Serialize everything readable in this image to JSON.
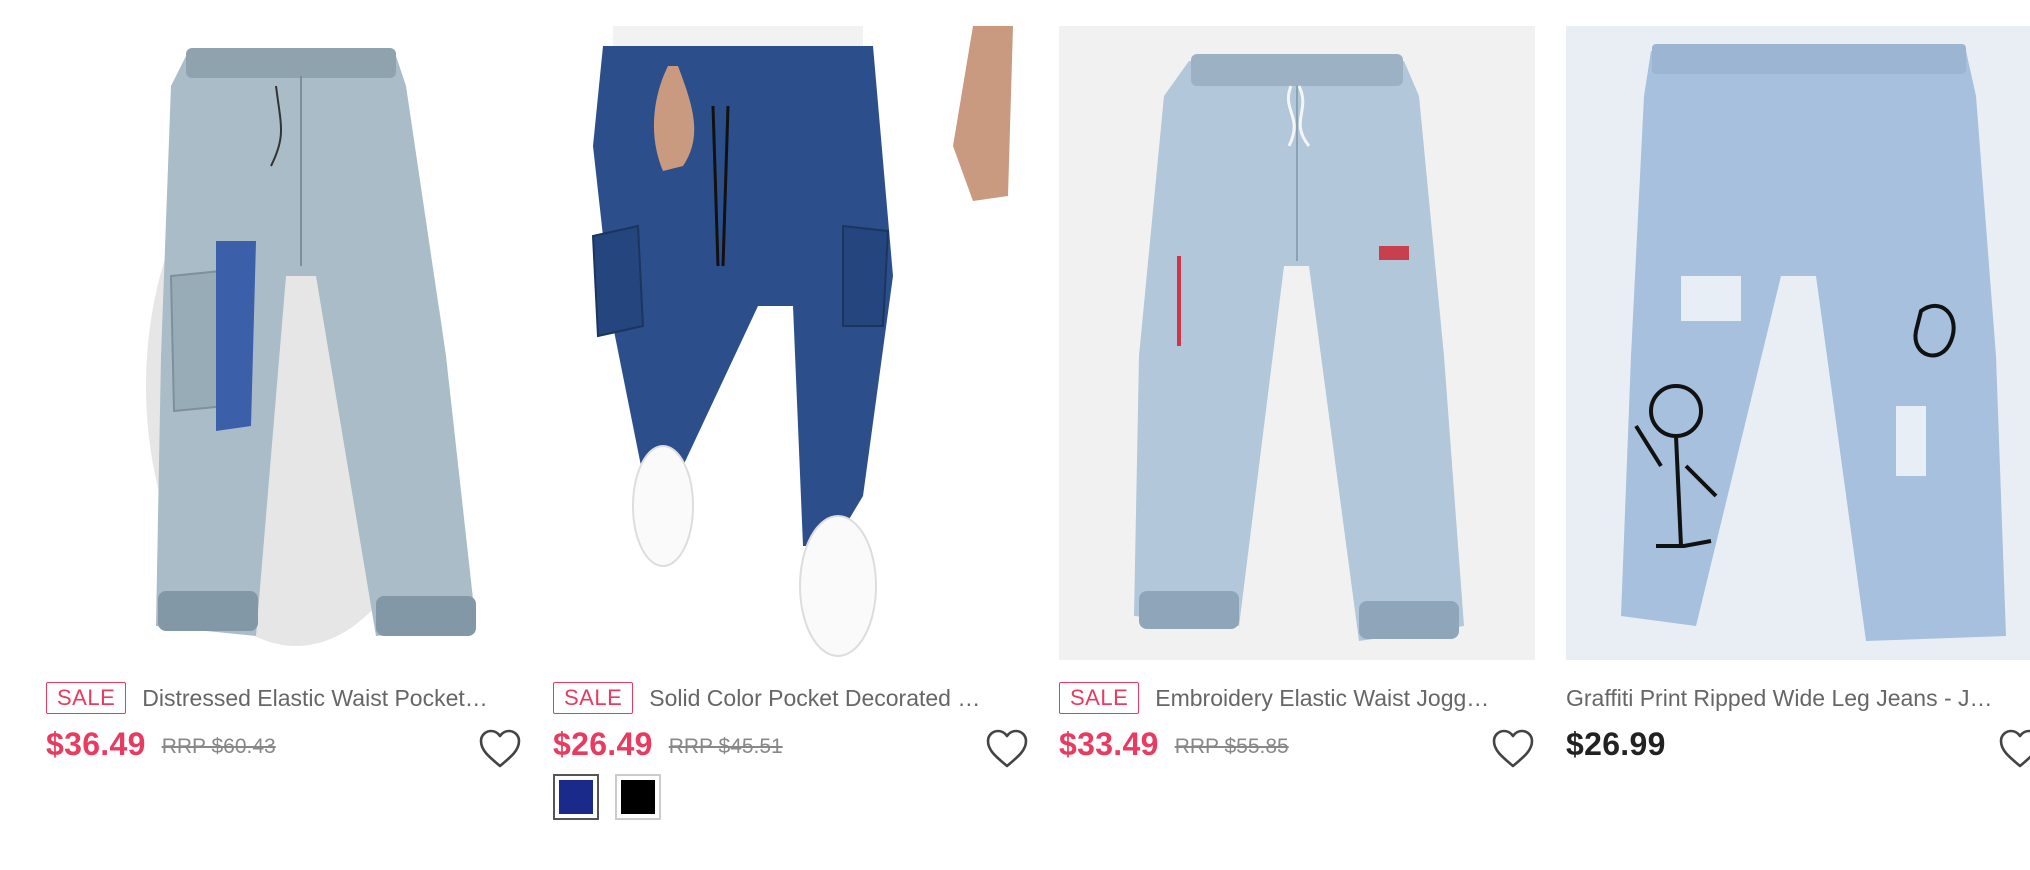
{
  "colors": {
    "accent_sale": "#e93a5f",
    "swatch_navy": "#1a2a8a",
    "swatch_black": "#000000"
  },
  "products": [
    {
      "badge": "SALE",
      "title": "Distressed Elastic Waist Pocket…",
      "price": "$36.49",
      "rrp": "RRP $60.43",
      "image_icon": "jeans-light-wash-jogger"
    },
    {
      "badge": "SALE",
      "title": "Solid Color Pocket Decorated …",
      "price": "$26.49",
      "rrp": "RRP $45.51",
      "image_icon": "jeans-dark-blue-cargo",
      "swatches": [
        "navy",
        "black"
      ]
    },
    {
      "badge": "SALE",
      "title": "Embroidery Elastic Waist Jogg…",
      "price": "$33.49",
      "rrp": "RRP $55.85",
      "image_icon": "jeans-light-blue-jogger"
    },
    {
      "title": "Graffiti Print Ripped Wide Leg Jeans - J…",
      "price": "$26.99",
      "image_icon": "jeans-graffiti-ripped"
    }
  ]
}
